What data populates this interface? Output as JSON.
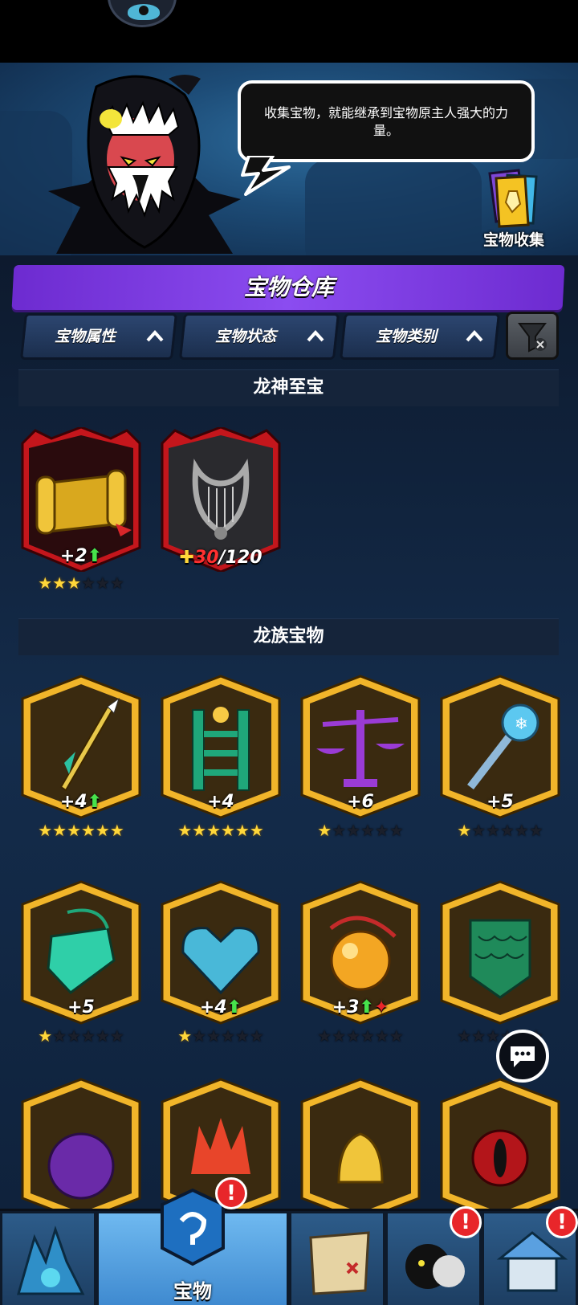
{
  "banner": {
    "dialog": "收集宝物，就能继承到宝物原主人强大的力量。",
    "collection_label": "宝物收集"
  },
  "warehouse": {
    "title": "宝物仓库",
    "filters": [
      {
        "label": "宝物属性"
      },
      {
        "label": "宝物状态"
      },
      {
        "label": "宝物类别"
      }
    ]
  },
  "sections": {
    "dragon_god": {
      "title": "龙神至宝",
      "items": [
        {
          "name": "scroll",
          "level": "+2",
          "upgrade": true,
          "stars": 3,
          "max_stars": 6
        },
        {
          "name": "lyre",
          "fragments": "30",
          "fragments_total": "/120"
        }
      ]
    },
    "dragon_clan": {
      "title": "龙族宝物",
      "items": [
        {
          "name": "spear",
          "level": "+4",
          "upgrade": true,
          "stars": 6,
          "max_stars": 6
        },
        {
          "name": "gate",
          "level": "+4",
          "upgrade": false,
          "stars": 6,
          "max_stars": 6
        },
        {
          "name": "scales",
          "level": "+6",
          "upgrade": false,
          "stars": 1,
          "max_stars": 6
        },
        {
          "name": "ice-scepter",
          "level": "+5",
          "upgrade": false,
          "stars": 1,
          "max_stars": 6
        },
        {
          "name": "emerald-amulet",
          "level": "+5",
          "upgrade": false,
          "stars": 1,
          "max_stars": 6
        },
        {
          "name": "ice-heart",
          "level": "+4",
          "upgrade": true,
          "stars": 1,
          "max_stars": 6
        },
        {
          "name": "amber-orb",
          "level": "+3",
          "upgrade": true,
          "stars": 0,
          "max_stars": 6
        },
        {
          "name": "dragon-scale-shield",
          "level": "",
          "upgrade": false,
          "stars": 0,
          "max_stars": 6
        }
      ]
    }
  },
  "nav": {
    "active_label": "宝物"
  },
  "colors": {
    "gold_frame": "#f1b52a",
    "red_frame": "#c4161c",
    "purple_header": "#7b3ae0",
    "star_on": "#ffd73a",
    "upgrade_arrow": "#47e24b",
    "badge": "#e8262a"
  }
}
